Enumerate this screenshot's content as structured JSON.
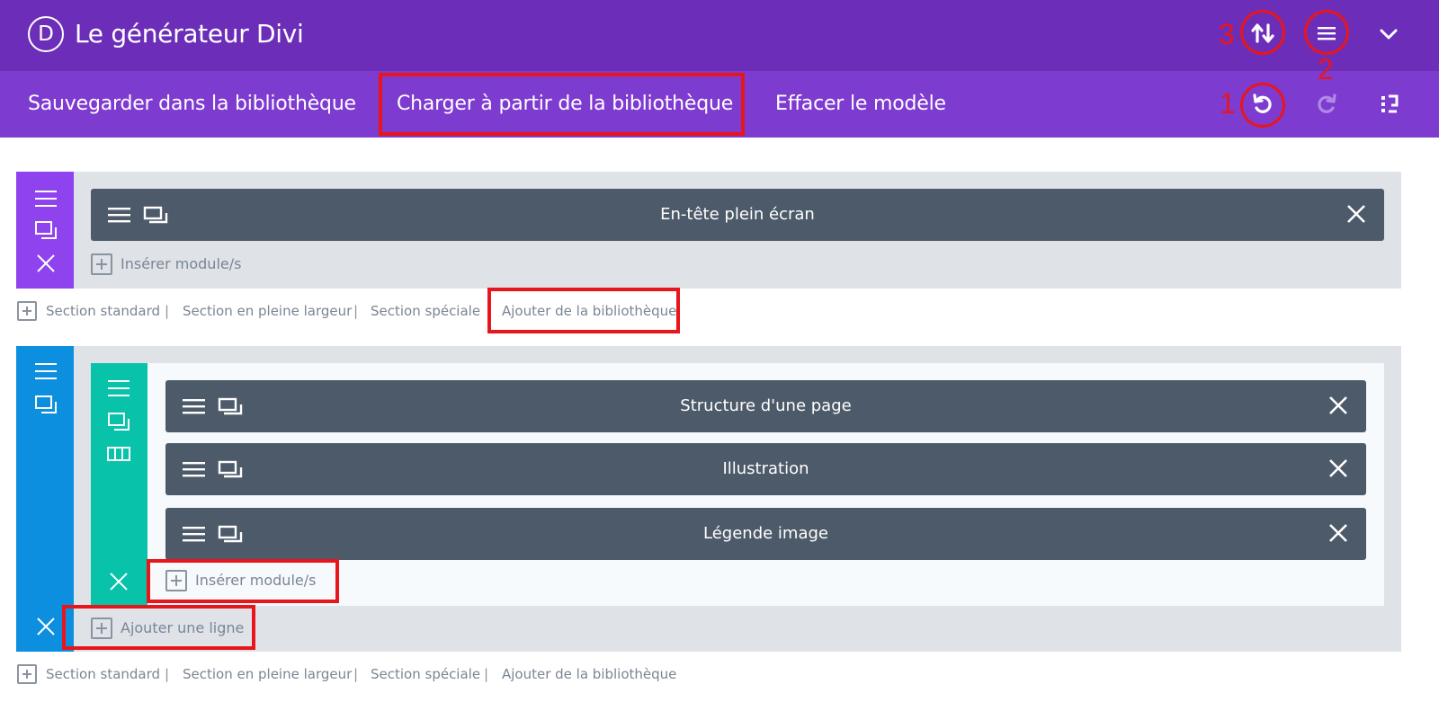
{
  "header": {
    "logo_letter": "D",
    "title": "Le générateur Divi"
  },
  "toolbar": {
    "save_label": "Sauvegarder dans la bibliothèque",
    "load_label": "Charger à partir de la bibliothèque",
    "clear_label": "Effacer le modèle"
  },
  "callouts": {
    "one": "1",
    "two": "2",
    "three": "3"
  },
  "section1": {
    "color": "#8f43ee",
    "module_title": "En-tête plein écran",
    "insert_label": "Insérer module/s"
  },
  "links1": {
    "standard": "Section standard",
    "fullwidth": "Section en pleine largeur",
    "special": "Section spéciale",
    "library": "Ajouter de la bibliothèque",
    "separator": "|"
  },
  "section2": {
    "color": "#0c8fde",
    "row_color": "#08c2aa",
    "modules": [
      {
        "title": "Structure d'une page"
      },
      {
        "title": "Illustration"
      },
      {
        "title": "Légende image"
      }
    ],
    "insert_label": "Insérer module/s",
    "add_row_label": "Ajouter une ligne"
  },
  "links2": {
    "standard": "Section standard",
    "fullwidth": "Section en pleine largeur",
    "special": "Section spéciale",
    "library": "Ajouter de la bibliothèque",
    "separator": "|"
  },
  "colors": {
    "header": "#6c2eb9",
    "toolbar": "#7e3bd0",
    "highlight": "#e8161b",
    "module": "#4d5a69"
  },
  "icons": [
    "portability-icon",
    "menu-icon",
    "chevron-down-icon",
    "undo-icon",
    "redo-icon",
    "layers-icon",
    "hamburger-icon",
    "duplicate-icon",
    "close-icon",
    "columns-icon",
    "plus-icon"
  ]
}
